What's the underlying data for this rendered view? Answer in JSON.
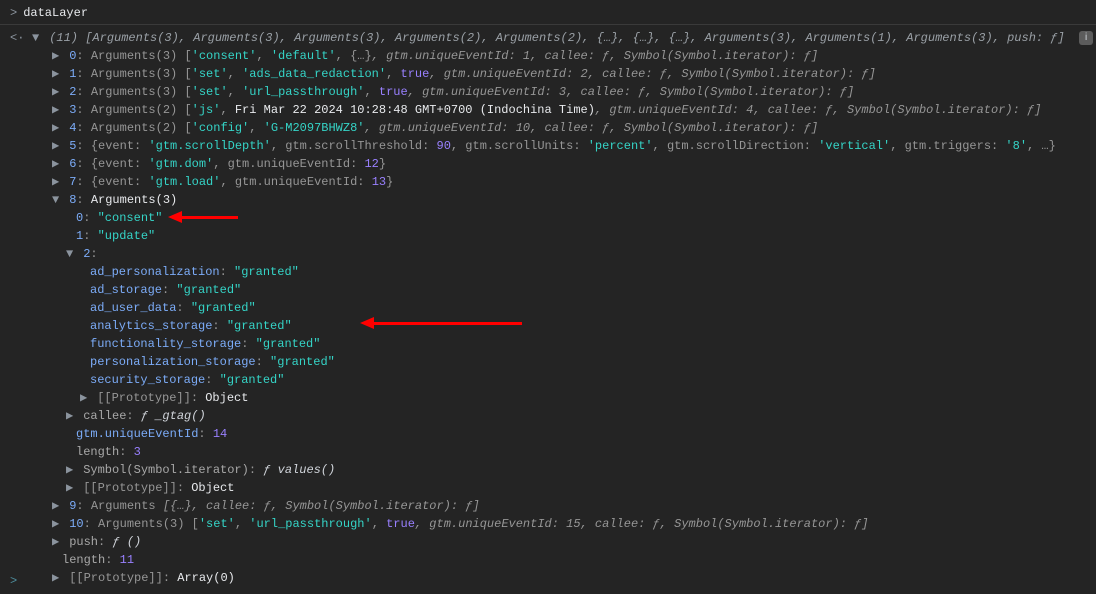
{
  "input_var": "dataLayer",
  "info_badge": "i",
  "summary": {
    "count": "(11)",
    "items": [
      "Arguments(3)",
      "Arguments(3)",
      "Arguments(3)",
      "Arguments(2)",
      "Arguments(2)",
      "{…}",
      "{…}",
      "{…}",
      "Arguments(3)",
      "Arguments(1)",
      "Arguments(3)"
    ],
    "push": "ƒ"
  },
  "rows": {
    "r0": {
      "idx": "0",
      "type": "Arguments(3)",
      "arr": [
        "'consent'",
        "'default'",
        "{…}"
      ],
      "tail": ", gtm.uniqueEventId: 1, callee: ƒ, Symbol(Symbol.iterator): ƒ]"
    },
    "r1": {
      "idx": "1",
      "type": "Arguments(3)",
      "arr": [
        "'set'",
        "'ads_data_redaction'",
        "true"
      ],
      "tail": ", gtm.uniqueEventId: 2, callee: ƒ, Symbol(Symbol.iterator): ƒ]"
    },
    "r2": {
      "idx": "2",
      "type": "Arguments(3)",
      "arr": [
        "'set'",
        "'url_passthrough'",
        "true"
      ],
      "tail": ", gtm.uniqueEventId: 3, callee: ƒ, Symbol(Symbol.iterator): ƒ]"
    },
    "r3": {
      "idx": "3",
      "type": "Arguments(2)",
      "arr": [
        "'js'",
        "Fri Mar 22 2024 10:28:48 GMT+0700 (Indochina Time)"
      ],
      "tail": ", gtm.uniqueEventId: 4, callee: ƒ, Symbol(Symbol.iterator): ƒ]"
    },
    "r4": {
      "idx": "4",
      "type": "Arguments(2)",
      "arr": [
        "'config'",
        "'G-M2097BHWZ8'"
      ],
      "tail": ", gtm.uniqueEventId: 10, callee: ƒ, Symbol(Symbol.iterator): ƒ]"
    },
    "r5": {
      "idx": "5",
      "obj": "{event: 'gtm.scrollDepth', gtm.scrollThreshold: 90, gtm.scrollUnits: 'percent', gtm.scrollDirection: 'vertical', gtm.triggers: '8', …}"
    },
    "r6": {
      "idx": "6",
      "obj": "{event: 'gtm.dom', gtm.uniqueEventId: 12}"
    },
    "r7": {
      "idx": "7",
      "obj": "{event: 'gtm.load', gtm.uniqueEventId: 13}"
    },
    "r8": {
      "idx": "8",
      "type": "Arguments(3)"
    },
    "r9": {
      "idx": "9",
      "type": "Arguments",
      "tail": " [{…}, callee: ƒ, Symbol(Symbol.iterator): ƒ]"
    },
    "r10": {
      "idx": "10",
      "type": "Arguments(3)",
      "arr": [
        "'set'",
        "'url_passthrough'",
        "true"
      ],
      "tail": ", gtm.uniqueEventId: 15, callee: ƒ, Symbol(Symbol.iterator): ƒ]"
    }
  },
  "exp8": {
    "k0": {
      "key": "0",
      "val": "\"consent\""
    },
    "k1": {
      "key": "1",
      "val": "\"update\""
    },
    "k2": {
      "key": "2"
    },
    "obj": {
      "ad_personalization": "\"granted\"",
      "ad_storage": "\"granted\"",
      "ad_user_data": "\"granted\"",
      "analytics_storage": "\"granted\"",
      "functionality_storage": "\"granted\"",
      "personalization_storage": "\"granted\"",
      "security_storage": "\"granted\""
    },
    "proto_obj": "[[Prototype]]: ",
    "proto_obj_val": "Object",
    "callee_key": "callee",
    "callee_val": "ƒ _gtag()",
    "uid_key": "gtm.uniqueEventId",
    "uid_val": "14",
    "len_key": "length",
    "len_val": "3",
    "sym_key": "Symbol(Symbol.iterator)",
    "sym_val": "ƒ values()",
    "proto2": "[[Prototype]]: ",
    "proto2_val": "Object"
  },
  "tail": {
    "push_key": "push",
    "push_val": "ƒ ()",
    "length_key": "length",
    "length_val": "11",
    "proto": "[[Prototype]]: ",
    "proto_val": "Array(0)"
  }
}
